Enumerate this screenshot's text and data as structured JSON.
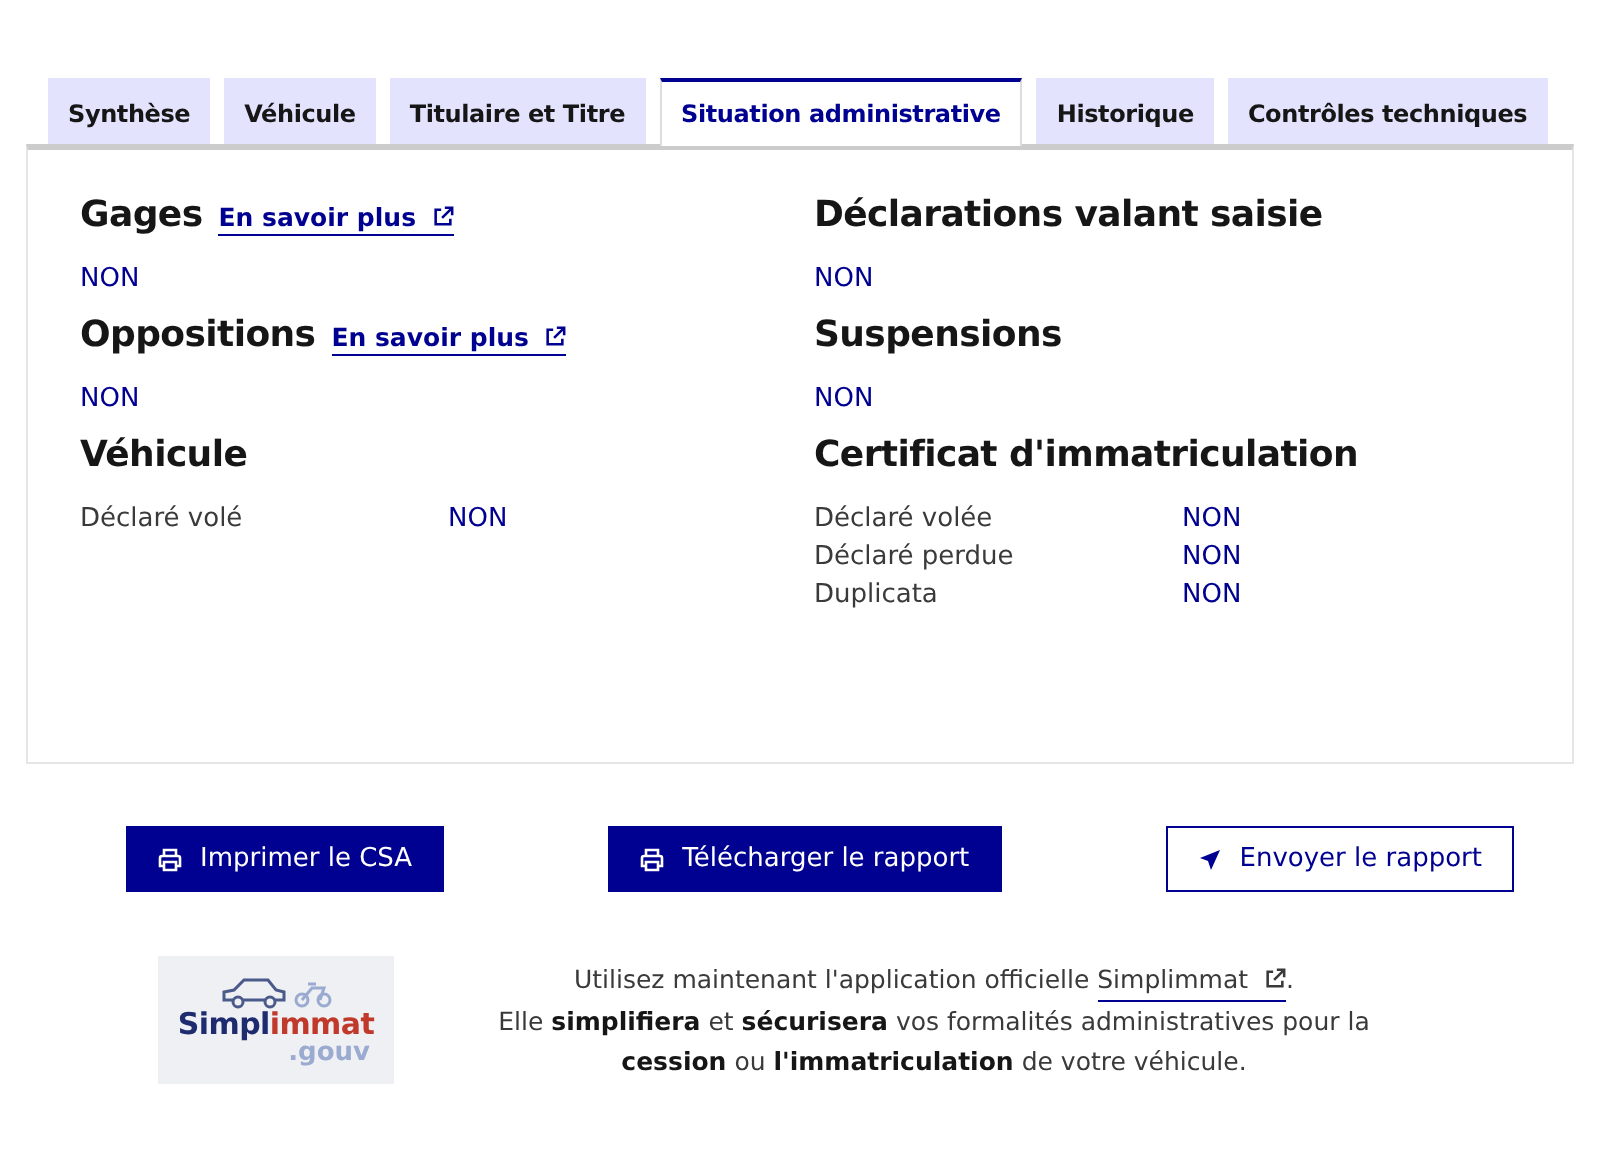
{
  "tabs": [
    {
      "label": "Synthèse",
      "selected": false
    },
    {
      "label": "Véhicule",
      "selected": false
    },
    {
      "label": "Titulaire et Titre",
      "selected": false
    },
    {
      "label": "Situation administrative",
      "selected": true
    },
    {
      "label": "Historique",
      "selected": false
    },
    {
      "label": "Contrôles techniques",
      "selected": false
    }
  ],
  "sections": [
    {
      "kind": "value",
      "title": "Gages",
      "link": "En savoir plus",
      "value": "NON"
    },
    {
      "kind": "value",
      "title": "Déclarations valant saisie",
      "value": "NON"
    },
    {
      "kind": "value",
      "title": "Oppositions",
      "link": "En savoir plus",
      "value": "NON"
    },
    {
      "kind": "value",
      "title": "Suspensions",
      "value": "NON"
    },
    {
      "kind": "table",
      "title": "Véhicule",
      "rows": [
        {
          "label": "Déclaré volé",
          "value": "NON"
        }
      ]
    },
    {
      "kind": "table",
      "title": "Certificat d'immatriculation",
      "rows": [
        {
          "label": "Déclaré volée",
          "value": "NON"
        },
        {
          "label": "Déclaré perdue",
          "value": "NON"
        },
        {
          "label": "Duplicata",
          "value": "NON"
        }
      ]
    }
  ],
  "buttons": [
    {
      "label": "Imprimer le CSA",
      "kind": "primary"
    },
    {
      "label": "Télécharger le rapport",
      "kind": "primary"
    },
    {
      "label": "Envoyer le rapport",
      "kind": "secondary"
    }
  ],
  "promo": {
    "logo": {
      "first": "Simpl",
      "second": "immat",
      "suffix": ".gouv"
    },
    "before": "Utilisez maintenant l'application officielle ",
    "link": "Simplimmat",
    "after": ".",
    "body": "Elle **simplifiera** et **sécurisera** vos formalités administratives pour la **cession** ou **l'immatriculation** de votre véhicule."
  }
}
